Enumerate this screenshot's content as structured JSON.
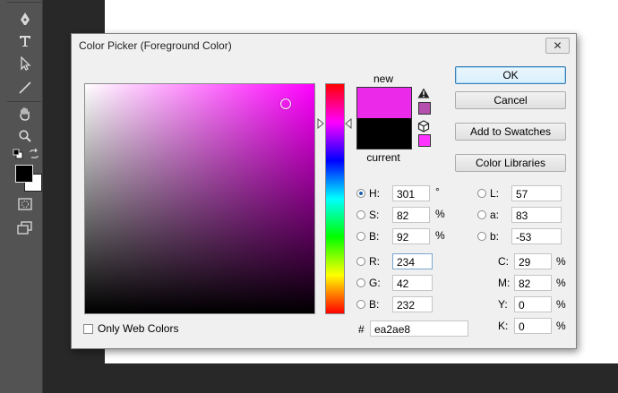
{
  "dialog": {
    "title": "Color Picker (Foreground Color)",
    "close_glyph": "✕"
  },
  "swatch": {
    "new_label": "new",
    "current_label": "current",
    "new_color": "#ea2ae8",
    "current_color": "#000000"
  },
  "buttons": {
    "ok": "OK",
    "cancel": "Cancel",
    "add_to_swatches": "Add to Swatches",
    "color_libraries": "Color Libraries"
  },
  "hsb": {
    "h": {
      "label": "H:",
      "value": "301",
      "unit": "°",
      "selected": true
    },
    "s": {
      "label": "S:",
      "value": "82",
      "unit": "%"
    },
    "b": {
      "label": "B:",
      "value": "92",
      "unit": "%"
    }
  },
  "rgb": {
    "r": {
      "label": "R:",
      "value": "234"
    },
    "g": {
      "label": "G:",
      "value": "42"
    },
    "b": {
      "label": "B:",
      "value": "232"
    }
  },
  "lab": {
    "l": {
      "label": "L:",
      "value": "57"
    },
    "a": {
      "label": "a:",
      "value": "83"
    },
    "b": {
      "label": "b:",
      "value": "-53"
    }
  },
  "cmyk": {
    "c": {
      "label": "C:",
      "value": "29",
      "unit": "%"
    },
    "m": {
      "label": "M:",
      "value": "82",
      "unit": "%"
    },
    "y": {
      "label": "Y:",
      "value": "0",
      "unit": "%"
    },
    "k": {
      "label": "K:",
      "value": "0",
      "unit": "%"
    }
  },
  "hex": {
    "label": "#",
    "value": "ea2ae8"
  },
  "only_web_colors": {
    "label": "Only Web Colors",
    "checked": false
  },
  "colors": {
    "accent": "#3c7fb1",
    "gamut_warning_swatch": "#b44fae",
    "web_safe_swatch": "#ff33ff"
  },
  "toolbar": {
    "tools": [
      "pen-icon",
      "type-icon",
      "path-selection-icon",
      "line-icon",
      "hand-icon",
      "zoom-icon",
      "default-colors-icon",
      "swap-colors-icon",
      "foreground-color-icon",
      "quick-mask-icon",
      "screen-mode-icon"
    ]
  }
}
